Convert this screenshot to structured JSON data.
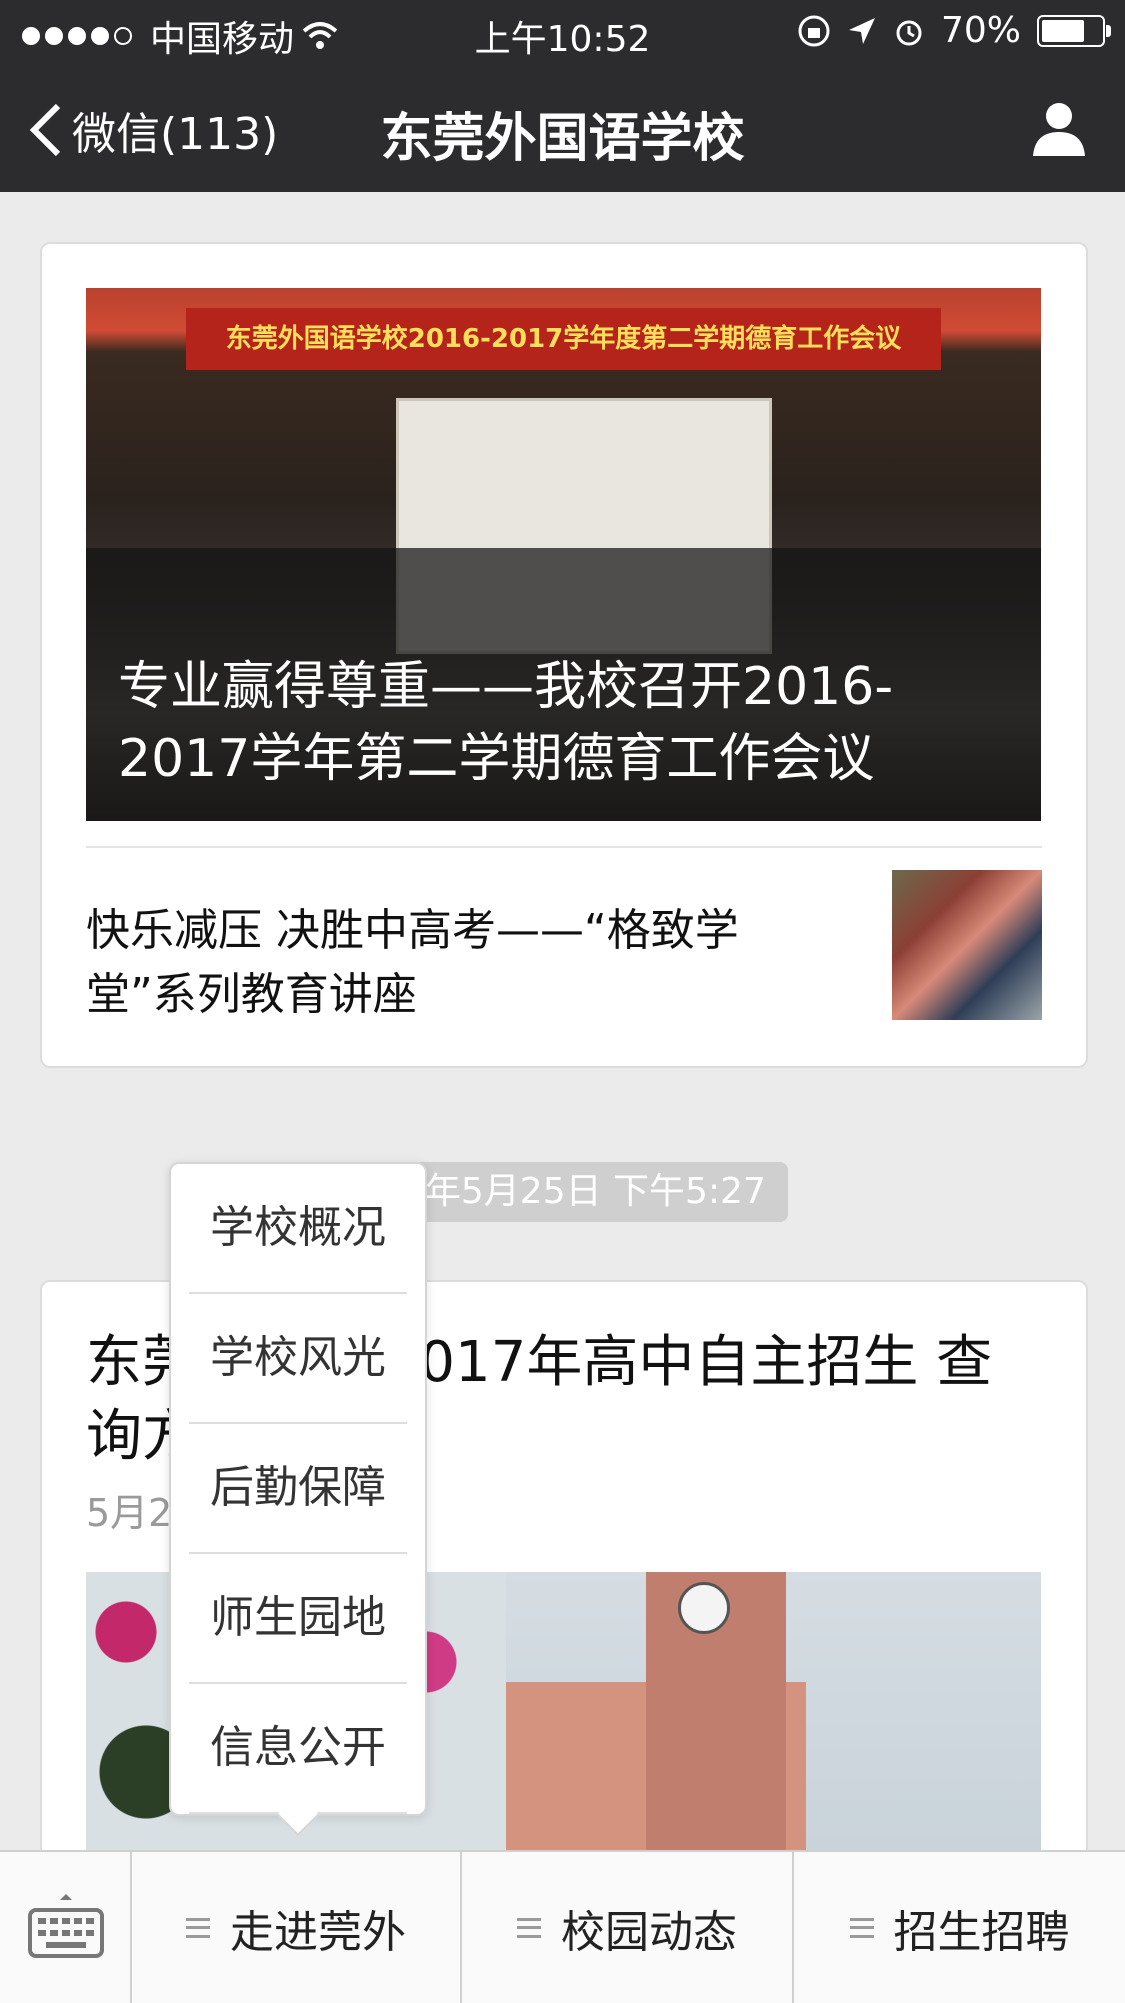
{
  "status_bar": {
    "carrier": "中国移动",
    "time": "上午10:52",
    "battery": "70%"
  },
  "nav": {
    "back_label": "微信(113)",
    "title": "东莞外国语学校"
  },
  "article_group_1": {
    "main_title": "专业赢得尊重——我校召开2016-2017学年第二学期德育工作会议",
    "cover_banner": "东莞外国语学校2016-2017学年度第二学期德育工作会议",
    "sub_article": "快乐减压 决胜中高考——“格致学堂”系列教育讲座"
  },
  "timestamp": "7年5月25日 下午5:27",
  "article_group_2": {
    "title_visible": "东莞        校关于2017年高中自主招生        查询方式的通知",
    "date_partial": "5月2"
  },
  "popup_menu": {
    "items": [
      "学校概况",
      "学校风光",
      "后勤保障",
      "师生园地",
      "信息公开"
    ]
  },
  "bottom_bar": {
    "tabs": [
      "走进莞外",
      "校园动态",
      "招生招聘"
    ]
  }
}
